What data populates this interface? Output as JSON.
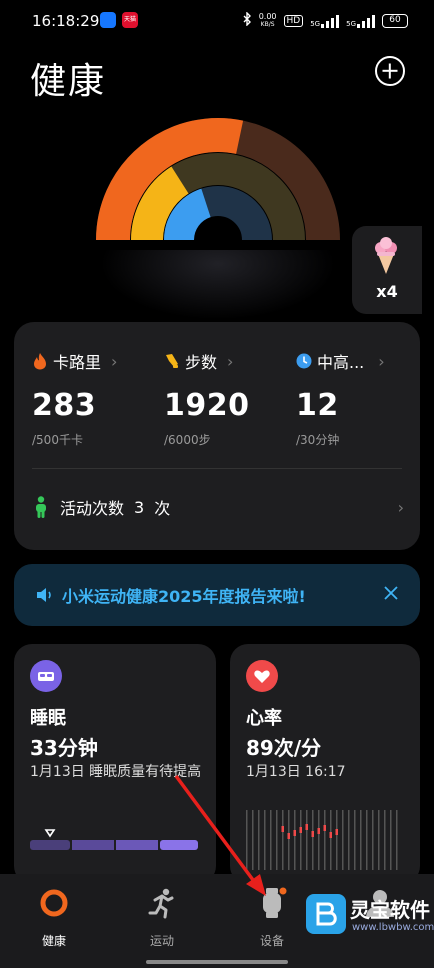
{
  "status_bar": {
    "time": "16:18:29",
    "app2_badge": "天猫",
    "net_speed_value": "0.00",
    "net_speed_unit": "KB/S",
    "hd_label": "HD",
    "sim1_label": "5G",
    "sim2_label": "5G",
    "battery": "60"
  },
  "header": {
    "title": "健康"
  },
  "achievement": {
    "count": "x4"
  },
  "stats": {
    "calories": {
      "label": "卡路里",
      "value": "283",
      "target": "/500千卡"
    },
    "steps": {
      "label": "步数",
      "value": "1920",
      "target": "/6000步"
    },
    "intensity": {
      "label": "中高...",
      "value": "12",
      "target": "/30分钟"
    },
    "activity_label": "活动次数",
    "activity_count": "3",
    "activity_unit": "次",
    "ring_progress": {
      "calories": 0.566,
      "steps": 0.32,
      "intensity": 0.4
    }
  },
  "banner": {
    "text": "小米运动健康2025年度报告来啦!"
  },
  "tiles": {
    "sleep": {
      "title": "睡眠",
      "value": "33分钟",
      "sub": "1月13日 睡眠质量有待提高"
    },
    "heart": {
      "title": "心率",
      "value": "89次/分",
      "sub": "1月13日 16:17"
    }
  },
  "nav": {
    "health": "健康",
    "workout": "运动",
    "device": "设备"
  },
  "watermark": {
    "name": "灵宝软件",
    "url": "www.lbwbw.com"
  },
  "colors": {
    "calories": "#f0671e",
    "steps": "#f5b417",
    "intensity": "#3c9df0",
    "banner_text": "#3fb4f5",
    "sleep_icon": "#7a63e6",
    "heart_icon": "#f04a4a"
  }
}
